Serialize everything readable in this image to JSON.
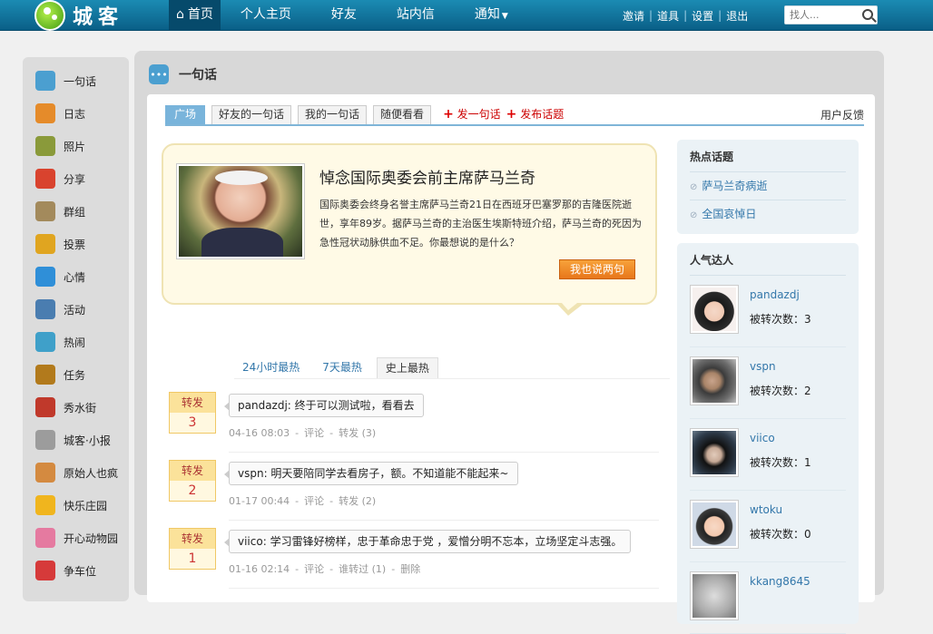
{
  "brand": {
    "name": "城客"
  },
  "nav": {
    "items": [
      "首页",
      "个人主页",
      "好友",
      "站内信",
      "通知"
    ]
  },
  "toplinks": [
    "邀请",
    "道具",
    "设置",
    "退出"
  ],
  "search": {
    "placeholder": "找人..."
  },
  "sidebar": {
    "items": [
      {
        "label": "一句话",
        "icon": "speech-bubble-icon",
        "color": "#4b9fd0"
      },
      {
        "label": "日志",
        "icon": "notepad-icon",
        "color": "#e58b2a"
      },
      {
        "label": "照片",
        "icon": "photo-icon",
        "color": "#8a9a3a"
      },
      {
        "label": "分享",
        "icon": "heart-icon",
        "color": "#d9432e"
      },
      {
        "label": "群组",
        "icon": "group-icon",
        "color": "#a38a5c"
      },
      {
        "label": "投票",
        "icon": "poll-icon",
        "color": "#e0a520"
      },
      {
        "label": "心情",
        "icon": "smiley-icon",
        "color": "#2f8fd8"
      },
      {
        "label": "活动",
        "icon": "people-icon",
        "color": "#4a7db0"
      },
      {
        "label": "热闹",
        "icon": "runner-icon",
        "color": "#3fa0c9"
      },
      {
        "label": "任务",
        "icon": "task-icon",
        "color": "#b27a1c"
      },
      {
        "label": "秀水街",
        "icon": "shop-icon",
        "color": "#c0392b"
      },
      {
        "label": "城客·小报",
        "icon": "newspaper-icon",
        "color": "#9c9c9c"
      },
      {
        "label": "原始人也疯",
        "icon": "caveman-icon",
        "color": "#d48a40"
      },
      {
        "label": "快乐庄园",
        "icon": "duck-icon",
        "color": "#f0b51e"
      },
      {
        "label": "开心动物园",
        "icon": "pig-icon",
        "color": "#e57aa0"
      },
      {
        "label": "争车位",
        "icon": "parking-icon",
        "color": "#d63a3a"
      }
    ]
  },
  "main": {
    "title": "一句话",
    "tabs": [
      "广场",
      "好友的一句话",
      "我的一句话",
      "随便看看"
    ],
    "actions": [
      "发一句话",
      "发布话题"
    ],
    "feedback": "用户反馈",
    "feature": {
      "title": "悼念国际奥委会前主席萨马兰奇",
      "body": "国际奥委会终身名誉主席萨马兰奇21日在西班牙巴塞罗那的吉隆医院逝世，享年89岁。据萨马兰奇的主治医生埃斯特班介绍，萨马兰奇的死因为急性冠状动脉供血不足。你最想说的是什么？",
      "button": "我也说两句"
    },
    "sort_tabs": [
      "24小时最热",
      "7天最热",
      "史上最热"
    ],
    "posts": [
      {
        "rt_label": "转发",
        "rt_count": "3",
        "text": "pandazdj: 终于可以测试啦，看看去",
        "meta": [
          "04-16 08:03",
          "-",
          "评论",
          "-",
          "转发 (3)"
        ]
      },
      {
        "rt_label": "转发",
        "rt_count": "2",
        "text": "vspn: 明天要陪同学去看房子，额。不知道能不能起来~",
        "meta": [
          "01-17 00:44",
          "-",
          "评论",
          "-",
          "转发 (2)"
        ]
      },
      {
        "rt_label": "转发",
        "rt_count": "1",
        "text": "viico: 学习雷锋好榜样，忠于革命忠于党 ，爱憎分明不忘本，立场坚定斗志强。",
        "meta": [
          "01-16 02:14",
          "-",
          "评论",
          "-",
          "谁转过 (1)",
          "-",
          "删除"
        ]
      }
    ]
  },
  "hot_topics": {
    "title": "热点话题",
    "items": [
      "萨马兰奇病逝",
      "全国哀悼日"
    ]
  },
  "popular_users": {
    "title": "人气达人",
    "users": [
      {
        "name": "pandazdj",
        "stat": "被转次数：3"
      },
      {
        "name": "vspn",
        "stat": "被转次数：2"
      },
      {
        "name": "viico",
        "stat": "被转次数：1"
      },
      {
        "name": "wtoku",
        "stat": "被转次数：0"
      },
      {
        "name": "kkang8645",
        "stat": ""
      }
    ]
  }
}
